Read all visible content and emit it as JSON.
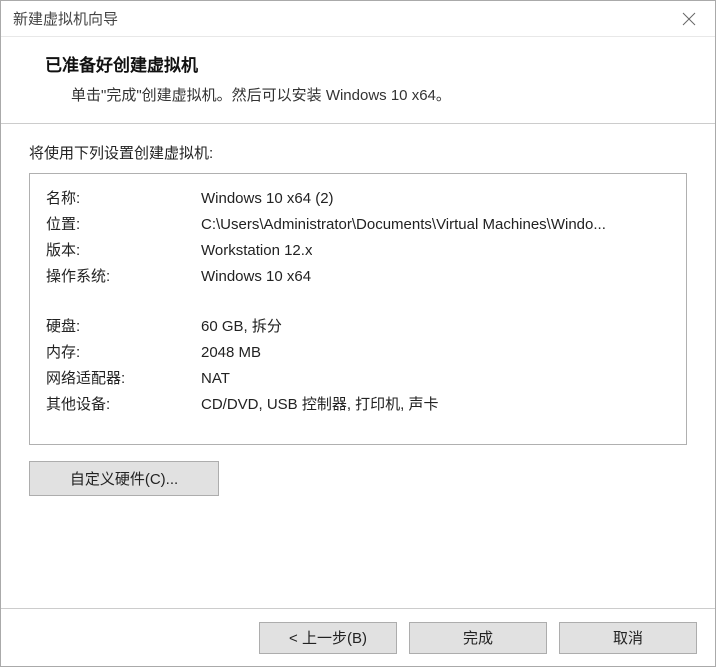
{
  "window": {
    "title": "新建虚拟机向导"
  },
  "header": {
    "title": "已准备好创建虚拟机",
    "subtitle": "单击\"完成\"创建虚拟机。然后可以安装 Windows 10 x64。"
  },
  "intro": "将使用下列设置创建虚拟机:",
  "summary": {
    "name_label": "名称:",
    "name_value": "Windows 10 x64 (2)",
    "location_label": "位置:",
    "location_value": "C:\\Users\\Administrator\\Documents\\Virtual Machines\\Windo...",
    "version_label": "版本:",
    "version_value": "Workstation 12.x",
    "os_label": "操作系统:",
    "os_value": "Windows 10 x64",
    "disk_label": "硬盘:",
    "disk_value": "60 GB, 拆分",
    "memory_label": "内存:",
    "memory_value": "2048 MB",
    "network_label": "网络适配器:",
    "network_value": "NAT",
    "other_label": "其他设备:",
    "other_value": "CD/DVD, USB 控制器, 打印机, 声卡"
  },
  "buttons": {
    "customize": "自定义硬件(C)...",
    "back": "< 上一步(B)",
    "finish": "完成",
    "cancel": "取消"
  }
}
